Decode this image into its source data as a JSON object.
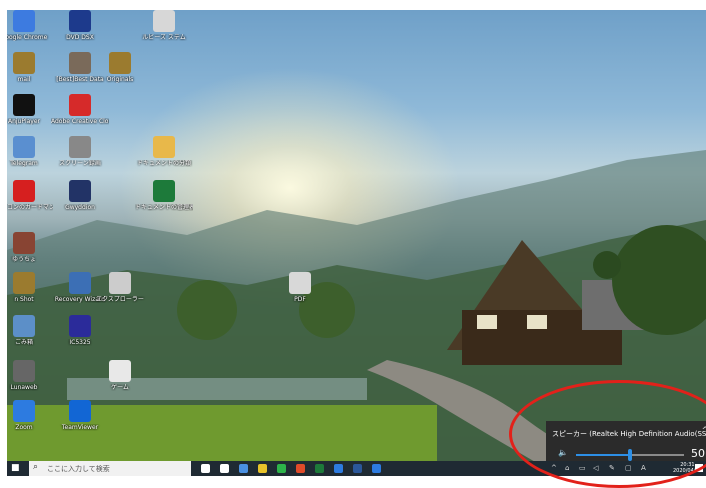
{
  "desktop": {
    "icons": [
      {
        "label": "Google Chrome",
        "color": "#3d7be0",
        "glyph": "chrome-icon"
      },
      {
        "label": "DVD DSX",
        "color": "#1d3a8c",
        "glyph": "dvd-icon"
      },
      {
        "label": "ルビーズ ステム",
        "color": "#d7d7d7",
        "glyph": "app-icon"
      },
      {
        "label": "mail",
        "color": "#9b7b2f",
        "glyph": "folder-icon"
      },
      {
        "label": "[Best]Best Data",
        "color": "#7a6a5a",
        "glyph": "photo-icon"
      },
      {
        "label": "Originals",
        "color": "#9b7b2f",
        "glyph": "folder-icon"
      },
      {
        "label": "AnjuPlayer",
        "color": "#111111",
        "glyph": "player-icon"
      },
      {
        "label": "Adobe Creative Cloud",
        "color": "#d62a2a",
        "glyph": "adobe-icon"
      },
      {
        "label": "Telegram",
        "color": "#5a8fd0",
        "glyph": "telegram-icon"
      },
      {
        "label": "スクリーン録画",
        "color": "#888888",
        "glyph": "app-icon"
      },
      {
        "label": "ドキュメントの分類",
        "color": "#e8b84a",
        "glyph": "folder-icon"
      },
      {
        "label": "パソコンのガードマン",
        "color": "#d61f1f",
        "glyph": "app-icon"
      },
      {
        "label": "Gwyddion",
        "color": "#223366",
        "glyph": "app-icon"
      },
      {
        "label": "ドキュメントの管理表",
        "color": "#1d7a3a",
        "glyph": "excel-icon"
      },
      {
        "label": "ゆうちょ",
        "color": "#884433",
        "glyph": "photo-icon"
      },
      {
        "label": "n Shot",
        "color": "#9b7b2f",
        "glyph": "folder-icon"
      },
      {
        "label": "Recovery Wizard",
        "color": "#3c6fb5",
        "glyph": "app-icon"
      },
      {
        "label": "エクスプローラー",
        "color": "#cccccc",
        "glyph": "app-icon"
      },
      {
        "label": "PDF",
        "color": "#d8d8d8",
        "glyph": "pdf-icon"
      },
      {
        "label": "ごみ箱",
        "color": "#5c8fc8",
        "glyph": "recycle-bin-icon"
      },
      {
        "label": "IC5325",
        "color": "#2b2b9a",
        "glyph": "app-icon"
      },
      {
        "label": "Lunaweb",
        "color": "#666666",
        "glyph": "app-icon"
      },
      {
        "label": "ゲーム",
        "color": "#e8e8e8",
        "glyph": "app-icon"
      },
      {
        "label": "Zoom",
        "color": "#2d7be0",
        "glyph": "zoom-icon"
      },
      {
        "label": "TeamViewer",
        "color": "#1266d4",
        "glyph": "teamviewer-icon"
      }
    ]
  },
  "volume": {
    "device_label": "スピーカー (Realtek High Definition Audio(SST))",
    "chevron": "^",
    "speaker_glyph": "🔈",
    "value_text": "50",
    "level": 0.5
  },
  "taskbar": {
    "start_glyph": "■",
    "search_placeholder": "ここに入力して検索",
    "search_glyph": "⌕",
    "tray_chevron": "^",
    "clock_time": "20:31",
    "clock_date": "2020/04/06",
    "ime": "A",
    "app_colors": [
      "#ffffff",
      "#ffffff",
      "#4a90e2",
      "#e8c32a",
      "#2db34a",
      "#e04b2a",
      "#1d7a3a",
      "#2d7be0",
      "#2b579a",
      "#2d7be0"
    ]
  }
}
